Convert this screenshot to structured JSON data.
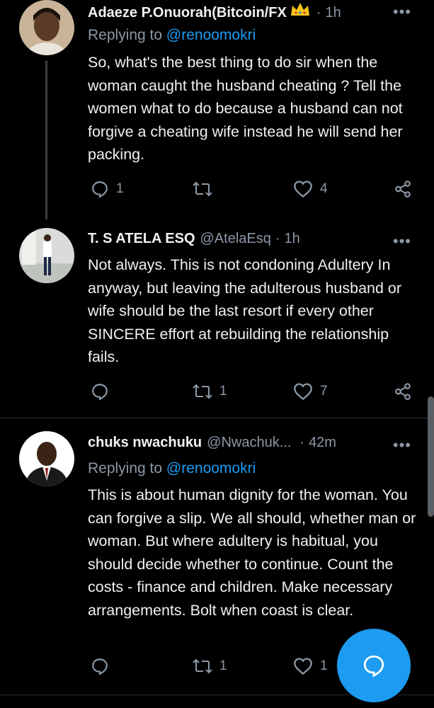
{
  "tweets": [
    {
      "name": "Adaeze P.Onuorah(Bitcoin/FX",
      "handle": "",
      "separator": "·",
      "time": "1h",
      "replying_prefix": "Replying to ",
      "replying_handle": "@renoomokri",
      "text": "So, what's the best thing to do sir when the woman caught the husband cheating ? Tell the women what to do because a husband can not forgive a cheating wife instead he will send her packing.",
      "replies": "1",
      "retweets": "",
      "likes": "4",
      "badge_icon": "crown-icon"
    },
    {
      "name": "T. S ATELA ESQ",
      "handle": "@AtelaEsq",
      "separator": "·",
      "time": "1h",
      "text": "Not always. This is not condoning Adultery In anyway, but leaving the  adulterous husband or wife should be the last resort  if every other SINCERE effort at rebuilding the relationship fails.",
      "replies": "",
      "retweets": "1",
      "likes": "7"
    },
    {
      "name": "chuks nwachuku",
      "handle": "@Nwachuk...",
      "separator": "·",
      "time": "42m",
      "replying_prefix": "Replying to ",
      "replying_handle": "@renoomokri",
      "text": "This is about human dignity for the woman. You can forgive a slip. We all should, whether man or woman. But where adultery is habitual, you should decide whether to continue. Count the costs - finance and children. Make necessary arrangements. Bolt when coast is clear.",
      "replies": "",
      "retweets": "1",
      "likes": "1"
    }
  ],
  "more_label": "•••",
  "fab_icon": "compose-reply-icon",
  "colors": {
    "accent": "#1d9bf0",
    "background": "#000000",
    "muted": "#8b98a5"
  }
}
